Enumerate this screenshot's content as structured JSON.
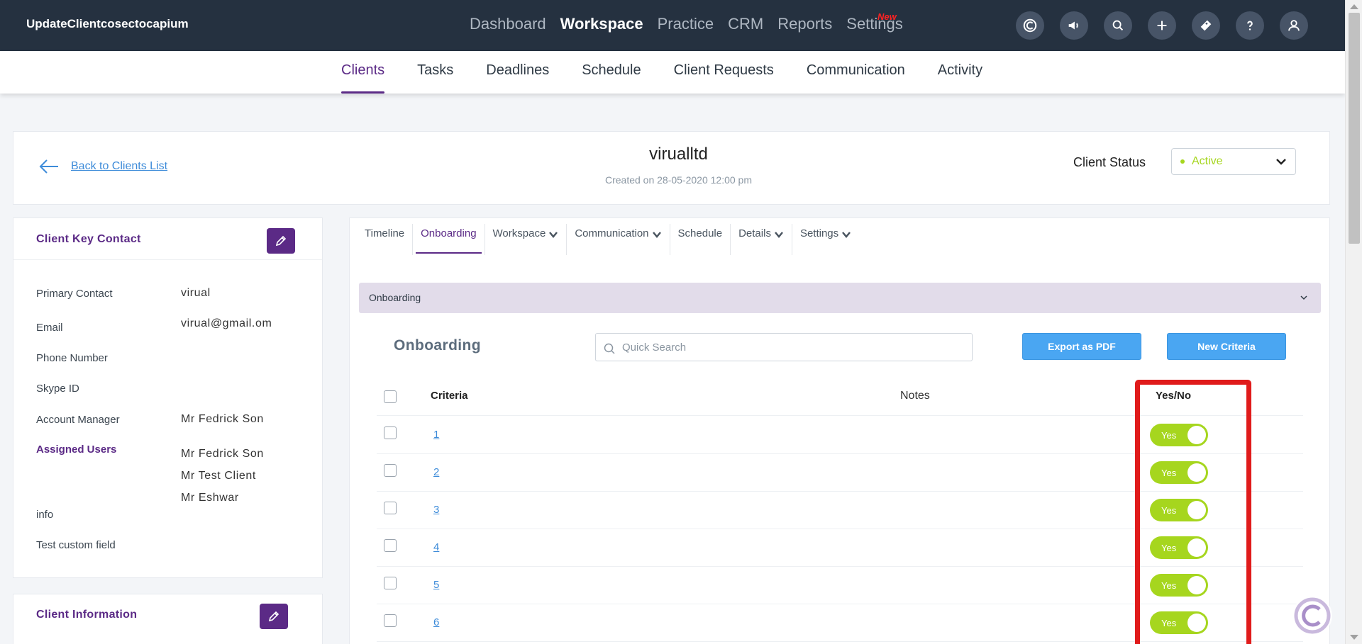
{
  "app": {
    "title": "UpdateClientcosectocapium"
  },
  "mainnav": {
    "items": [
      {
        "label": "Dashboard"
      },
      {
        "label": "Workspace"
      },
      {
        "label": "Practice"
      },
      {
        "label": "CRM"
      },
      {
        "label": "Reports"
      },
      {
        "label": "Settings"
      }
    ],
    "active": "Workspace",
    "new_badge": "New"
  },
  "topicons": [
    "capium-logo-icon",
    "megaphone-icon",
    "search-icon",
    "plus-icon",
    "ticket-icon",
    "help-icon",
    "user-icon"
  ],
  "subnav": {
    "tabs": [
      {
        "label": "Clients"
      },
      {
        "label": "Tasks"
      },
      {
        "label": "Deadlines"
      },
      {
        "label": "Schedule"
      },
      {
        "label": "Client Requests"
      },
      {
        "label": "Communication"
      },
      {
        "label": "Activity"
      }
    ],
    "active": "Clients"
  },
  "client_header": {
    "back_label": "Back to Clients List",
    "name": "virualltd",
    "created": "Created on 28-05-2020 12:00 pm",
    "status_label": "Client Status",
    "status_value": "Active"
  },
  "key_contact": {
    "title": "Client Key Contact",
    "fields": [
      {
        "label": "Primary Contact",
        "value": "virual"
      },
      {
        "label": "Email",
        "value": "virual@gmail.om"
      },
      {
        "label": "Phone Number",
        "value": ""
      },
      {
        "label": "Skype ID",
        "value": ""
      },
      {
        "label": "Account Manager",
        "value": "Mr Fedrick Son"
      }
    ],
    "assigned_users_label": "Assigned Users",
    "assigned_users": [
      "Mr Fedrick Son",
      "Mr Test Client",
      "Mr Eshwar"
    ],
    "extra_fields": [
      {
        "label": "info"
      },
      {
        "label": "Test custom field"
      }
    ]
  },
  "client_information": {
    "title": "Client Information"
  },
  "content_tabs": [
    {
      "label": "Timeline",
      "dropdown": false
    },
    {
      "label": "Onboarding",
      "dropdown": false
    },
    {
      "label": "Workspace",
      "dropdown": true
    },
    {
      "label": "Communication",
      "dropdown": true
    },
    {
      "label": "Schedule",
      "dropdown": false
    },
    {
      "label": "Details",
      "dropdown": true
    },
    {
      "label": "Settings",
      "dropdown": true
    }
  ],
  "content_active_tab": "Onboarding",
  "onboarding": {
    "accordion_title": "Onboarding",
    "section_title": "Onboarding",
    "search_placeholder": "Quick Search",
    "export_label": "Export as PDF",
    "new_criteria_label": "New Criteria",
    "columns": {
      "criteria": "Criteria",
      "notes": "Notes",
      "yesno": "Yes/No"
    },
    "rows": [
      {
        "criteria": "1",
        "notes": "",
        "toggle": "Yes"
      },
      {
        "criteria": "2",
        "notes": "",
        "toggle": "Yes"
      },
      {
        "criteria": "3",
        "notes": "",
        "toggle": "Yes"
      },
      {
        "criteria": "4",
        "notes": "",
        "toggle": "Yes"
      },
      {
        "criteria": "5",
        "notes": "",
        "toggle": "Yes"
      },
      {
        "criteria": "6",
        "notes": "",
        "toggle": "Yes"
      }
    ]
  },
  "colors": {
    "topbar": "#253140",
    "accent_purple": "#5b2a86",
    "button_blue": "#4aa6f2",
    "toggle_green": "#a6d61e",
    "highlight_red": "#e01b1b"
  }
}
